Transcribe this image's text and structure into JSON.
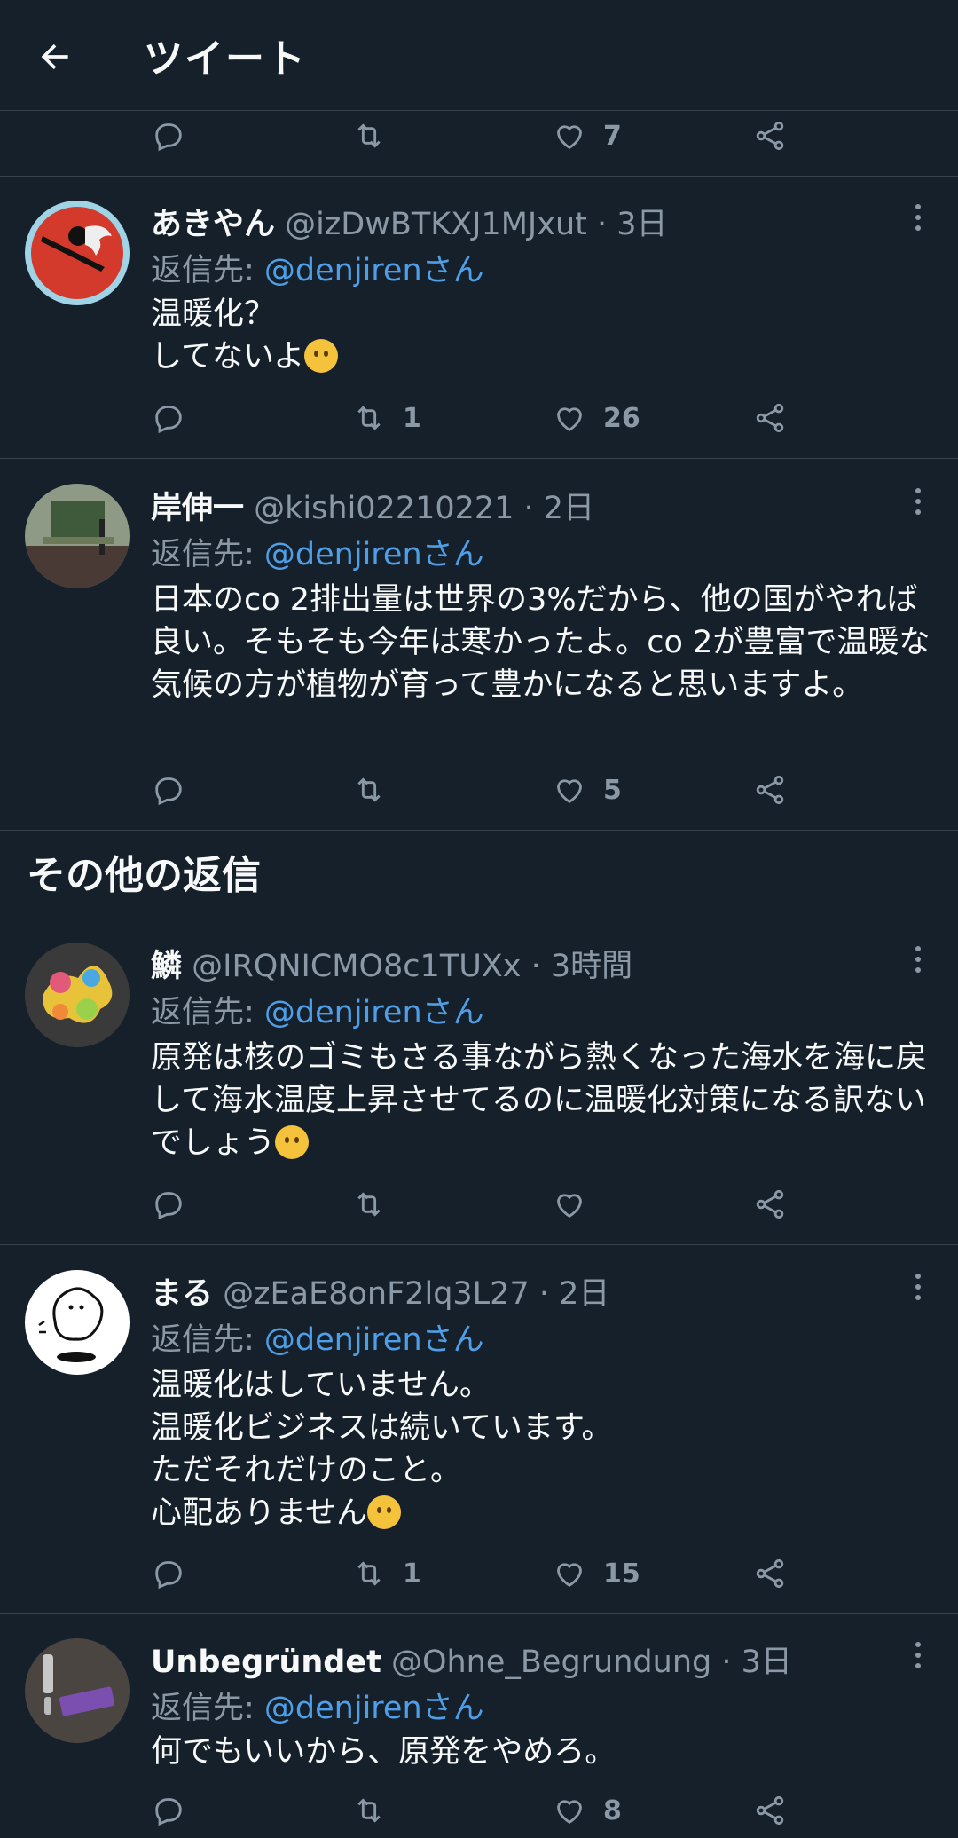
{
  "header": {
    "title": "ツイート"
  },
  "top_actions": {
    "likes": "7"
  },
  "reply_prefix": "返信先: ",
  "section_title": "その他の返信",
  "tweets": [
    {
      "name": "あきやん",
      "handle": "@izDwBTKXJ1MJxut · 3日",
      "reply_to": "@denjirenさん",
      "text": "温暖化？\nしてないよ",
      "emoji": "hugging-face",
      "retweets": "1",
      "likes": "26",
      "avatar_color": "#d33a2c"
    },
    {
      "name": "岸伸一",
      "handle": "@kishi02210221 · 2日",
      "reply_to": "@denjirenさん",
      "text": "日本のco 2排出量は世界の3%だから、他の国がやれば良い。そもそも今年は寒かったよ。co 2が豊富で温暖な気候の方が植物が育って豊かになると思いますよ。",
      "retweets": "",
      "likes": "5",
      "avatar_color": "#5b6b52"
    },
    {
      "name": "鱗",
      "handle": "@IRQNICMO8c1TUXx · 3時間",
      "reply_to": "@denjirenさん",
      "text": "原発は核のゴミもさる事ながら熱くなった海水を海に戻して海水温度上昇させてるのに温暖化対策になる訳ないでしょう",
      "emoji": "confounded-face",
      "retweets": "",
      "likes": "",
      "avatar_color": "#3a3a3a"
    },
    {
      "name": "まる",
      "handle": "@zEaE8onF2lq3L27 · 2日",
      "reply_to": "@denjirenさん",
      "text": "温暖化はしていません。\n温暖化ビジネスは続いています。\nただそれだけのこと。\n心配ありません",
      "emoji": "woozy-face",
      "retweets": "1",
      "likes": "15",
      "avatar_color": "#ffffff"
    },
    {
      "name": "Unbegründet",
      "handle": "@Ohne_Begrundung · 3日",
      "reply_to": "@denjirenさん",
      "text": "何でもいいから、原発をやめろ。",
      "retweets": "",
      "likes": "8",
      "avatar_color": "#4a4540"
    }
  ]
}
